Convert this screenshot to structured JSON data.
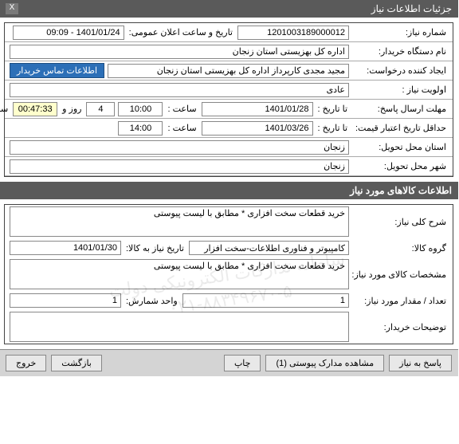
{
  "window": {
    "title": "جزئیات اطلاعات نیاز",
    "close_icon": "X"
  },
  "labels": {
    "need_no": "شماره نیاز:",
    "announce_date": "تاریخ و ساعت اعلان عمومی:",
    "buyer_org": "نام دستگاه خریدار:",
    "requester": "ایجاد کننده درخواست:",
    "priority": "اولویت نیاز :",
    "reply_deadline": "مهلت ارسال پاسخ:",
    "to_date": "تا تاریخ :",
    "hour": "ساعت :",
    "days_and": "روز و",
    "hours_left": "ساعت باقی مانده",
    "price_validity": "حداقل تاریخ اعتبار قیمت:",
    "delivery_province": "استان محل تحویل:",
    "delivery_city": "شهر محل تحویل:",
    "contact_btn": "اطلاعات تماس خریدار",
    "section2_title": "اطلاعات کالاهای مورد نیاز",
    "general_desc": "شرح کلی نیاز:",
    "goods_group": "گروه کالا:",
    "need_by_date": "تاریخ نیاز به کالا:",
    "item_spec": "مشخصات کالای مورد نیاز:",
    "qty": "تعداد / مقدار مورد نیاز:",
    "unit": "واحد شمارش:",
    "buyer_notes": "توضیحات خریدار:"
  },
  "values": {
    "need_no": "1201003189000012",
    "announce_date": "1401/01/24 - 09:09",
    "buyer_org": "اداره کل بهزیستی استان زنجان",
    "requester": "مجید مجدی کارپرداز اداره کل بهزیستی استان زنجان",
    "priority": "عادی",
    "reply_to_date": "1401/01/28",
    "reply_to_time": "10:00",
    "days_left": "4",
    "time_left": "00:47:33",
    "price_to_date": "1401/03/26",
    "price_to_time": "14:00",
    "province": "زنجان",
    "city": "زنجان",
    "general_desc": "خرید قطعات سخت افزاری * مطابق با لیست پیوستی",
    "goods_group": "کامپیوتر و فناوری اطلاعات-سخت افزار",
    "need_by_date": "1401/01/30",
    "item_spec": "خرید قطعات سخت افزاری * مطابق با لیست پیوستی",
    "qty": "1",
    "unit": "1",
    "buyer_notes": ""
  },
  "footer": {
    "reply": "پاسخ به نیاز",
    "attachments": "مشاهده مدارک پیوستی (1)",
    "print": "چاپ",
    "back": "بازگشت",
    "exit": "خروج"
  },
  "watermark": {
    "line1": "سامانه تدارکات الکترونیکی دولت",
    "line2": "۰۲۱-۸۸۳۴۹۶۷۰-۵"
  }
}
